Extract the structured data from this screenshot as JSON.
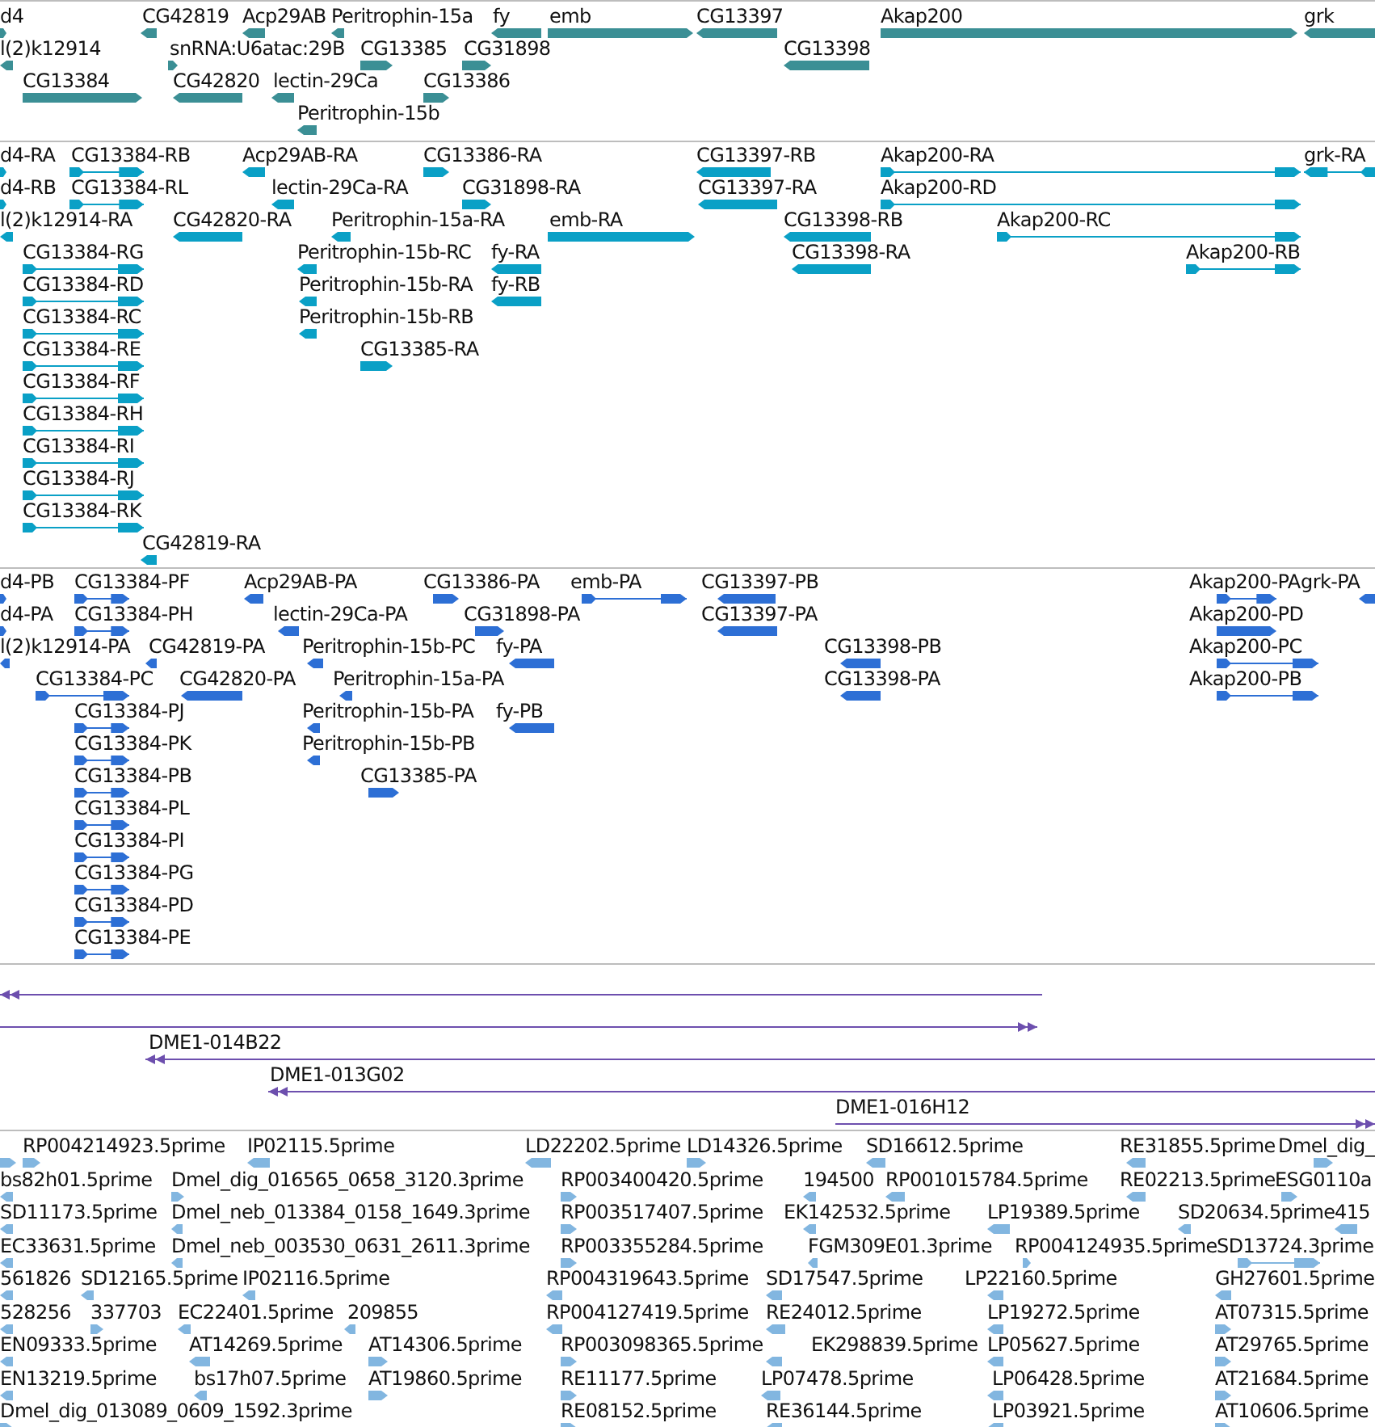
{
  "tracks": [
    {
      "kind": "gene",
      "features": [
        {
          "label": "d4",
          "reverse": false,
          "kind": "block"
        },
        {
          "label": "CG42819",
          "reverse": true,
          "kind": "block"
        },
        {
          "label": "Acp29AB",
          "reverse": true,
          "kind": "block"
        },
        {
          "label": "Peritrophin-15a",
          "reverse": true,
          "kind": "block"
        },
        {
          "label": "fy",
          "reverse": true,
          "kind": "block"
        },
        {
          "label": "emb",
          "reverse": false,
          "kind": "block"
        },
        {
          "label": "CG13397",
          "reverse": true,
          "kind": "block"
        },
        {
          "label": "Akap200",
          "reverse": false,
          "kind": "block"
        },
        {
          "label": "grk",
          "reverse": true,
          "kind": "block"
        },
        {
          "label": "l(2)k12914",
          "reverse": true,
          "kind": "block"
        },
        {
          "label": "snRNA:U6atac:29B",
          "reverse": false,
          "kind": "block"
        },
        {
          "label": "CG13385",
          "reverse": false,
          "kind": "block"
        },
        {
          "label": "CG31898",
          "reverse": false,
          "kind": "block"
        },
        {
          "label": "CG13398",
          "reverse": true,
          "kind": "block"
        },
        {
          "label": "CG13384",
          "reverse": false,
          "kind": "block"
        },
        {
          "label": "CG42820",
          "reverse": true,
          "kind": "block"
        },
        {
          "label": "lectin-29Ca",
          "reverse": true,
          "kind": "block"
        },
        {
          "label": "CG13386",
          "reverse": false,
          "kind": "block"
        },
        {
          "label": "Peritrophin-15b",
          "reverse": true,
          "kind": "block"
        }
      ]
    },
    {
      "kind": "transcript",
      "features": [
        {
          "label": "d4-RA",
          "reverse": false,
          "kind": "block"
        },
        {
          "label": "CG13384-RB",
          "reverse": false,
          "kind": "spliced"
        },
        {
          "label": "Acp29AB-RA",
          "reverse": true,
          "kind": "block"
        },
        {
          "label": "CG13386-RA",
          "reverse": false,
          "kind": "block"
        },
        {
          "label": "CG13397-RB",
          "reverse": true,
          "kind": "block"
        },
        {
          "label": "Akap200-RA",
          "reverse": false,
          "kind": "spliced"
        },
        {
          "label": "grk-RA",
          "reverse": true,
          "kind": "spliced"
        },
        {
          "label": "d4-RB",
          "reverse": false,
          "kind": "block"
        },
        {
          "label": "CG13384-RL",
          "reverse": false,
          "kind": "spliced"
        },
        {
          "label": "lectin-29Ca-RA",
          "reverse": true,
          "kind": "block"
        },
        {
          "label": "CG31898-RA",
          "reverse": false,
          "kind": "block"
        },
        {
          "label": "CG13397-RA",
          "reverse": true,
          "kind": "block"
        },
        {
          "label": "Akap200-RD",
          "reverse": false,
          "kind": "spliced"
        },
        {
          "label": "l(2)k12914-RA",
          "reverse": true,
          "kind": "block"
        },
        {
          "label": "CG42820-RA",
          "reverse": true,
          "kind": "block"
        },
        {
          "label": "Peritrophin-15a-RA",
          "reverse": true,
          "kind": "block"
        },
        {
          "label": "emb-RA",
          "reverse": false,
          "kind": "block"
        },
        {
          "label": "CG13398-RB",
          "reverse": true,
          "kind": "block"
        },
        {
          "label": "Akap200-RC",
          "reverse": false,
          "kind": "spliced"
        },
        {
          "label": "CG13384-RG",
          "reverse": false,
          "kind": "spliced"
        },
        {
          "label": "Peritrophin-15b-RC",
          "reverse": true,
          "kind": "block"
        },
        {
          "label": "fy-RA",
          "reverse": true,
          "kind": "block"
        },
        {
          "label": "CG13398-RA",
          "reverse": true,
          "kind": "block"
        },
        {
          "label": "Akap200-RB",
          "reverse": false,
          "kind": "spliced"
        },
        {
          "label": "CG13384-RD",
          "reverse": false,
          "kind": "spliced"
        },
        {
          "label": "Peritrophin-15b-RA",
          "reverse": true,
          "kind": "block"
        },
        {
          "label": "fy-RB",
          "reverse": true,
          "kind": "block"
        },
        {
          "label": "CG13384-RC",
          "reverse": false,
          "kind": "spliced"
        },
        {
          "label": "Peritrophin-15b-RB",
          "reverse": true,
          "kind": "block"
        },
        {
          "label": "CG13384-RE",
          "reverse": false,
          "kind": "spliced"
        },
        {
          "label": "CG13385-RA",
          "reverse": false,
          "kind": "block"
        },
        {
          "label": "CG13384-RF",
          "reverse": false,
          "kind": "spliced"
        },
        {
          "label": "CG13384-RH",
          "reverse": false,
          "kind": "spliced"
        },
        {
          "label": "CG13384-RI",
          "reverse": false,
          "kind": "spliced"
        },
        {
          "label": "CG13384-RJ",
          "reverse": false,
          "kind": "spliced"
        },
        {
          "label": "CG13384-RK",
          "reverse": false,
          "kind": "spliced"
        },
        {
          "label": "CG42819-RA",
          "reverse": true,
          "kind": "block"
        }
      ]
    },
    {
      "kind": "protein",
      "features": [
        {
          "label": "d4-PB",
          "reverse": false,
          "kind": "block"
        },
        {
          "label": "CG13384-PF",
          "reverse": false,
          "kind": "spliced"
        },
        {
          "label": "Acp29AB-PA",
          "reverse": true,
          "kind": "block"
        },
        {
          "label": "CG13386-PA",
          "reverse": false,
          "kind": "block"
        },
        {
          "label": "emb-PA",
          "reverse": false,
          "kind": "spliced"
        },
        {
          "label": "CG13397-PB",
          "reverse": true,
          "kind": "block"
        },
        {
          "label": "Akap200-PA",
          "reverse": false,
          "kind": "spliced"
        },
        {
          "label": "grk-PA",
          "reverse": true,
          "kind": "block"
        },
        {
          "label": "d4-PA",
          "reverse": false,
          "kind": "block"
        },
        {
          "label": "CG13384-PH",
          "reverse": false,
          "kind": "spliced"
        },
        {
          "label": "lectin-29Ca-PA",
          "reverse": true,
          "kind": "block"
        },
        {
          "label": "CG31898-PA",
          "reverse": false,
          "kind": "block"
        },
        {
          "label": "CG13397-PA",
          "reverse": true,
          "kind": "block"
        },
        {
          "label": "Akap200-PD",
          "reverse": false,
          "kind": "block"
        },
        {
          "label": "l(2)k12914-PA",
          "reverse": true,
          "kind": "block"
        },
        {
          "label": "CG42819-PA",
          "reverse": true,
          "kind": "block"
        },
        {
          "label": "Peritrophin-15b-PC",
          "reverse": true,
          "kind": "block"
        },
        {
          "label": "fy-PA",
          "reverse": true,
          "kind": "block"
        },
        {
          "label": "CG13398-PB",
          "reverse": true,
          "kind": "block"
        },
        {
          "label": "Akap200-PC",
          "reverse": false,
          "kind": "spliced"
        },
        {
          "label": "CG13384-PC",
          "reverse": false,
          "kind": "spliced"
        },
        {
          "label": "CG42820-PA",
          "reverse": true,
          "kind": "block"
        },
        {
          "label": "Peritrophin-15a-PA",
          "reverse": true,
          "kind": "block"
        },
        {
          "label": "CG13398-PA",
          "reverse": true,
          "kind": "block"
        },
        {
          "label": "Akap200-PB",
          "reverse": false,
          "kind": "spliced"
        },
        {
          "label": "CG13384-PJ",
          "reverse": false,
          "kind": "spliced"
        },
        {
          "label": "Peritrophin-15b-PA",
          "reverse": true,
          "kind": "block"
        },
        {
          "label": "fy-PB",
          "reverse": true,
          "kind": "block"
        },
        {
          "label": "CG13384-PK",
          "reverse": false,
          "kind": "spliced"
        },
        {
          "label": "Peritrophin-15b-PB",
          "reverse": true,
          "kind": "block"
        },
        {
          "label": "CG13384-PB",
          "reverse": false,
          "kind": "spliced"
        },
        {
          "label": "CG13385-PA",
          "reverse": false,
          "kind": "block"
        },
        {
          "label": "CG13384-PL",
          "reverse": false,
          "kind": "spliced"
        },
        {
          "label": "CG13384-PI",
          "reverse": false,
          "kind": "spliced"
        },
        {
          "label": "CG13384-PG",
          "reverse": false,
          "kind": "spliced"
        },
        {
          "label": "CG13384-PD",
          "reverse": false,
          "kind": "spliced"
        },
        {
          "label": "CG13384-PE",
          "reverse": false,
          "kind": "spliced"
        }
      ]
    },
    {
      "kind": "clone",
      "features": [
        {
          "reverse": true,
          "kind": "line"
        },
        {
          "reverse": false,
          "kind": "line"
        },
        {
          "label": "DME1-014B22",
          "reverse": true,
          "kind": "line"
        },
        {
          "label": "DME1-013G02",
          "reverse": true,
          "kind": "line"
        },
        {
          "label": "DME1-016H12",
          "reverse": false,
          "kind": "line"
        }
      ]
    },
    {
      "kind": "est",
      "features": [
        {
          "reverse": false,
          "kind": "block"
        },
        {
          "label": "RP004214923.5prime",
          "reverse": false,
          "kind": "block"
        },
        {
          "label": "IP02115.5prime",
          "reverse": true,
          "kind": "block"
        },
        {
          "label": "LD22202.5prime",
          "reverse": true,
          "kind": "block"
        },
        {
          "label": "LD14326.5prime",
          "reverse": false,
          "kind": "block"
        },
        {
          "label": "SD16612.5prime",
          "reverse": true,
          "kind": "block"
        },
        {
          "label": "RE31855.5prime",
          "reverse": true,
          "kind": "block"
        },
        {
          "label": "Dmel_dig_",
          "reverse": false,
          "kind": "block"
        },
        {
          "label": "bs82h01.5prime",
          "reverse": true,
          "kind": "block"
        },
        {
          "label": "Dmel_dig_016565_0658_3120.3prime",
          "reverse": false,
          "kind": "block"
        },
        {
          "label": "RP003400420.5prime",
          "reverse": false,
          "kind": "block"
        },
        {
          "label": "194500",
          "reverse": true,
          "kind": "block"
        },
        {
          "label": "RP001015784.5prime",
          "reverse": true,
          "kind": "block"
        },
        {
          "label": "RE02213.5prime",
          "reverse": true,
          "kind": "block"
        },
        {
          "label": "ESG0110a",
          "reverse": false,
          "kind": "block"
        },
        {
          "label": "SD11173.5prime",
          "reverse": true,
          "kind": "block"
        },
        {
          "label": "Dmel_neb_013384_0158_1649.3prime",
          "reverse": true,
          "kind": "block"
        },
        {
          "label": "RP003517407.5prime",
          "reverse": false,
          "kind": "block"
        },
        {
          "label": "EK142532.5prime",
          "reverse": true,
          "kind": "block"
        },
        {
          "label": "LP19389.5prime",
          "reverse": true,
          "kind": "block"
        },
        {
          "label": "SD20634.5prime",
          "reverse": true,
          "kind": "block"
        },
        {
          "label": "415",
          "reverse": true,
          "kind": "block"
        },
        {
          "label": "EC33631.5prime",
          "reverse": true,
          "kind": "block"
        },
        {
          "label": "Dmel_neb_003530_0631_2611.3prime",
          "reverse": true,
          "kind": "block"
        },
        {
          "label": "RP003355284.5prime",
          "reverse": false,
          "kind": "block"
        },
        {
          "label": "FGM309E01.3prime",
          "reverse": true,
          "kind": "block"
        },
        {
          "label": "RP004124935.5prime",
          "reverse": false,
          "kind": "block"
        },
        {
          "label": "SD13724.3prime",
          "reverse": false,
          "kind": "spliced"
        },
        {
          "label": "561826",
          "reverse": true,
          "kind": "block"
        },
        {
          "label": "SD12165.5prime",
          "reverse": true,
          "kind": "block"
        },
        {
          "label": "IP02116.5prime",
          "reverse": true,
          "kind": "block"
        },
        {
          "label": "RP004319643.5prime",
          "reverse": true,
          "kind": "block"
        },
        {
          "label": "SD17547.5prime",
          "reverse": true,
          "kind": "block"
        },
        {
          "label": "LP22160.5prime",
          "reverse": true,
          "kind": "block"
        },
        {
          "label": "GH27601.5prime",
          "reverse": true,
          "kind": "block"
        },
        {
          "label": "528256",
          "reverse": true,
          "kind": "block"
        },
        {
          "label": "337703",
          "reverse": false,
          "kind": "block"
        },
        {
          "label": "EC22401.5prime",
          "reverse": true,
          "kind": "block"
        },
        {
          "label": "209855",
          "reverse": true,
          "kind": "block"
        },
        {
          "label": "RP004127419.5prime",
          "reverse": true,
          "kind": "block"
        },
        {
          "label": "RE24012.5prime",
          "reverse": true,
          "kind": "block"
        },
        {
          "label": "LP19272.5prime",
          "reverse": true,
          "kind": "block"
        },
        {
          "label": "AT07315.5prime",
          "reverse": false,
          "kind": "block"
        },
        {
          "label": "EN09333.5prime",
          "reverse": true,
          "kind": "block"
        },
        {
          "label": "AT14269.5prime",
          "reverse": true,
          "kind": "block"
        },
        {
          "label": "AT14306.5prime",
          "reverse": false,
          "kind": "block"
        },
        {
          "label": "RP003098365.5prime",
          "reverse": false,
          "kind": "block"
        },
        {
          "label": "EK298839.5prime",
          "reverse": true,
          "kind": "block"
        },
        {
          "label": "LP05627.5prime",
          "reverse": true,
          "kind": "block"
        },
        {
          "label": "AT29765.5prime",
          "reverse": false,
          "kind": "block"
        },
        {
          "label": "EN13219.5prime",
          "reverse": true,
          "kind": "block"
        },
        {
          "label": "bs17h07.5prime",
          "reverse": true,
          "kind": "block"
        },
        {
          "label": "AT19860.5prime",
          "reverse": false,
          "kind": "block"
        },
        {
          "label": "RE11177.5prime",
          "reverse": false,
          "kind": "block"
        },
        {
          "label": "LP07478.5prime",
          "reverse": true,
          "kind": "block"
        },
        {
          "label": "LP06428.5prime",
          "reverse": true,
          "kind": "block"
        },
        {
          "label": "AT21684.5prime",
          "reverse": false,
          "kind": "block"
        },
        {
          "label": "Dmel_dig_013089_0609_1592.3prime",
          "reverse": false,
          "kind": "block"
        },
        {
          "label": "RE08152.5prime",
          "reverse": false,
          "kind": "block"
        },
        {
          "label": "RE36144.5prime",
          "reverse": true,
          "kind": "block"
        },
        {
          "label": "LP03921.5prime",
          "reverse": true,
          "kind": "block"
        },
        {
          "label": "AT10606.5prime",
          "reverse": false,
          "kind": "block"
        }
      ]
    }
  ]
}
